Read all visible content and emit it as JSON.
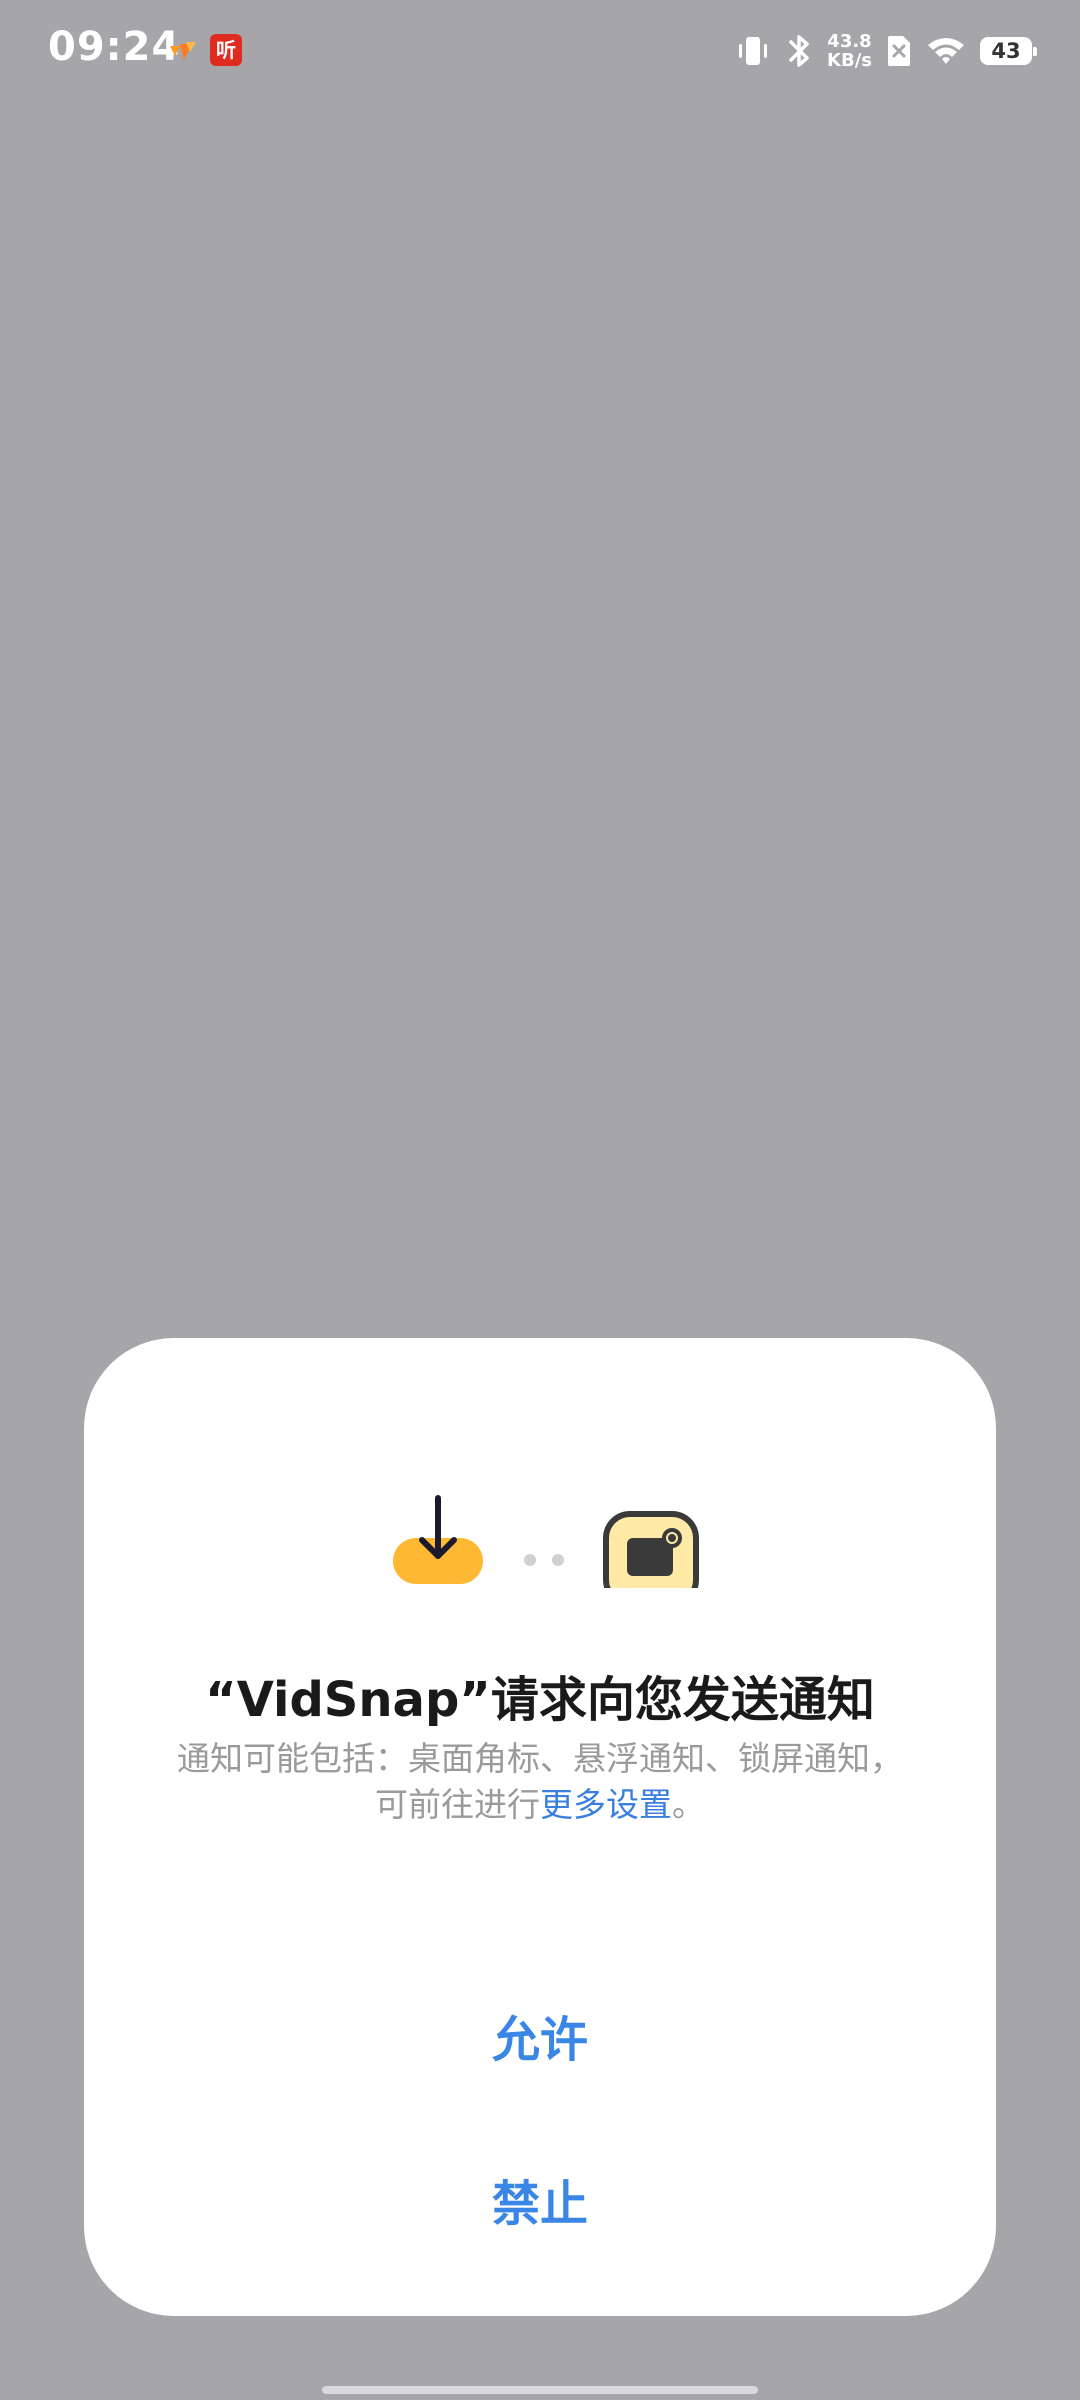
{
  "status_bar": {
    "time": "09:24",
    "net_speed_value": "43.8",
    "net_speed_unit": "KB/s",
    "battery_level": "43",
    "listen_app_glyph": "听"
  },
  "dialog": {
    "title": "“VidSnap”请求向您发送通知",
    "desc_line1": "通知可能包括：桌面角标、悬浮通知、锁屏通知，",
    "desc_line2_prefix": "可前往进行",
    "desc_link": "更多设置",
    "desc_line2_suffix": "。",
    "allow_label": "允许",
    "deny_label": "禁止"
  },
  "colors": {
    "background_dim": "#a6a6aa",
    "accent": "#3a86e6",
    "app_icon_yellow": "#ffb833",
    "notif_icon_bg": "#ffe9a6"
  },
  "icons": {
    "app_icon": "download-arrow-icon",
    "notification_icon": "notification-bell-icon"
  }
}
